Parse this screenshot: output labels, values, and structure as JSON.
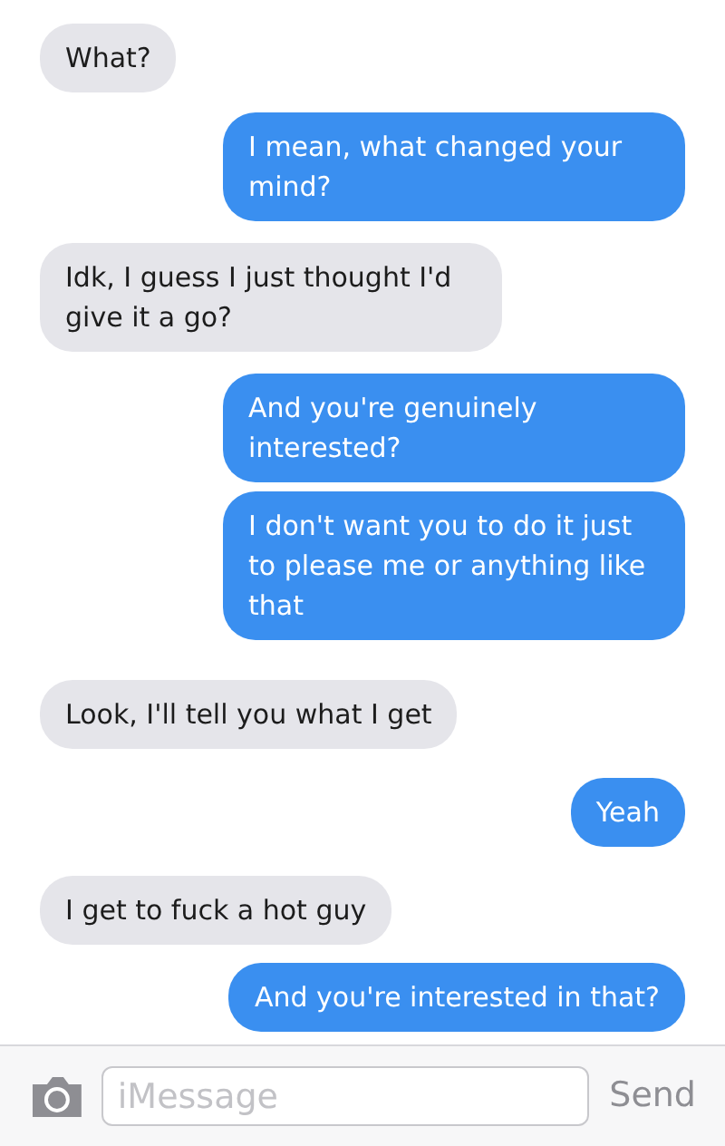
{
  "messages": [
    {
      "kind": "received",
      "text": "What?"
    },
    {
      "kind": "sent",
      "text": "I mean, what changed your mind?"
    },
    {
      "kind": "received",
      "text": "Idk, I guess I just thought I'd give it a go?"
    },
    {
      "kind": "sent",
      "text": "And you're genuinely interested?"
    },
    {
      "kind": "sent",
      "text": "I don't want you to do it just to please me or anything like that"
    },
    {
      "kind": "received",
      "text": "Look, I'll tell you what I get"
    },
    {
      "kind": "sent",
      "text": "Yeah"
    },
    {
      "kind": "received",
      "text": "I get to fuck a hot guy"
    },
    {
      "kind": "sent",
      "text": "And you're interested in that?"
    }
  ],
  "composer": {
    "placeholder": "iMessage",
    "send_label": "Send"
  }
}
